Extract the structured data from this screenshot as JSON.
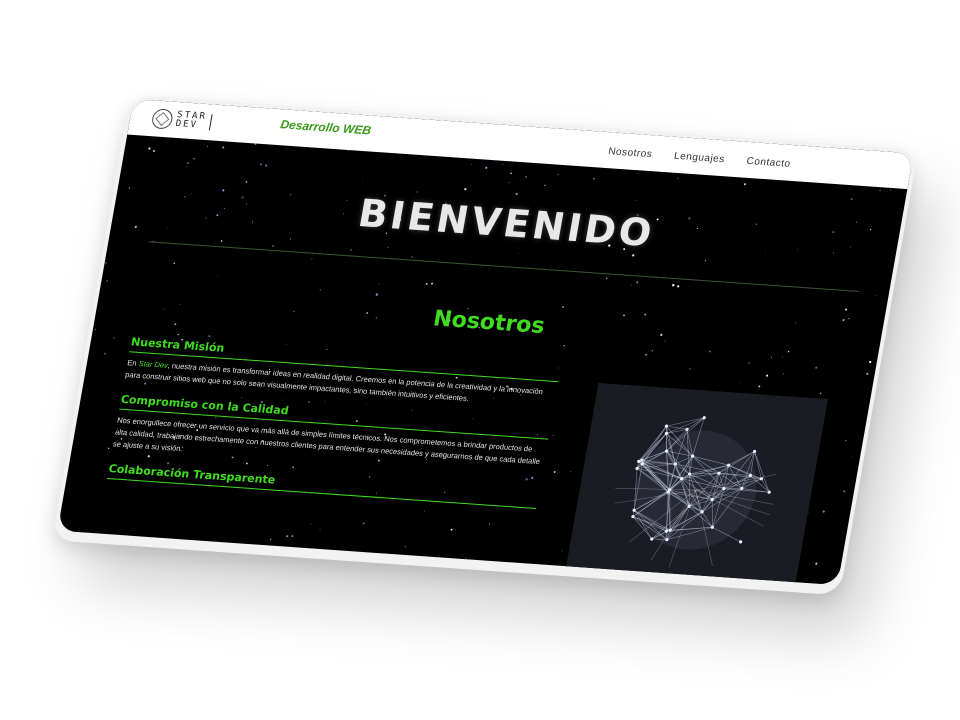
{
  "navbar": {
    "logo_text": "STAR\nDEV",
    "brand_title": "Desarrollo WEB",
    "links": [
      "Nosotros",
      "Lenguajes",
      "Contacto"
    ]
  },
  "hero": {
    "title": "BIENVENIDO"
  },
  "about": {
    "title": "Nosotros",
    "blocks": [
      {
        "title": "Nuestra Misión",
        "text_before": "En ",
        "highlight": "Star Dev",
        "text_after": ", nuestra misión es transformar ideas en realidad digital. Creemos en la potencia de la creatividad y la innovación para construir sitios web que no solo sean visualmente impactantes, sino también intuitivos y eficientes."
      },
      {
        "title": "Compromiso con la Calidad",
        "text": "Nos enorgullece ofrecer un servicio que va más allá de simples límites técnicos. Nos comprometemos a brindar productos de alta calidad, trabajando estrechamente con nuestros clientes para entender sus necesidades y asegurarnos de que cada detalle se ajuste a su visión."
      },
      {
        "title": "Colaboración Transparente",
        "text": ""
      }
    ]
  },
  "colors": {
    "accent": "#3fdc1f",
    "brand": "#3a9a1a",
    "background": "#000000",
    "navbar": "#ffffff"
  },
  "icons": {
    "logo": "star-dev-logo-icon"
  }
}
